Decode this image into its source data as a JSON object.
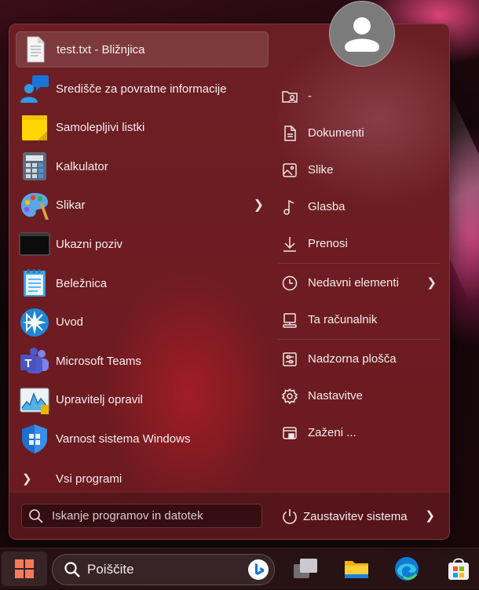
{
  "start_menu": {
    "apps": [
      {
        "label": "test.txt - Bližnjica",
        "icon": "text-file-icon"
      },
      {
        "label": "Središče za povratne informacije",
        "icon": "feedback-hub-icon"
      },
      {
        "label": "Samolepljivi listki",
        "icon": "sticky-notes-icon"
      },
      {
        "label": "Kalkulator",
        "icon": "calculator-icon"
      },
      {
        "label": "Slikar",
        "icon": "paint-icon"
      },
      {
        "label": "Ukazni poziv",
        "icon": "command-prompt-icon"
      },
      {
        "label": "Beležnica",
        "icon": "notepad-icon"
      },
      {
        "label": "Uvod",
        "icon": "get-started-icon"
      },
      {
        "label": "Microsoft Teams",
        "icon": "teams-icon"
      },
      {
        "label": "Upravitelj opravil",
        "icon": "task-manager-icon"
      },
      {
        "label": "Varnost sistema Windows",
        "icon": "windows-security-icon"
      }
    ],
    "all_programs_label": "Vsi programi",
    "search_placeholder": "Iskanje programov in datotek",
    "right_items": [
      {
        "label": "-",
        "icon": "user-folder-icon"
      },
      {
        "label": "Dokumenti",
        "icon": "document-icon"
      },
      {
        "label": "Slike",
        "icon": "pictures-icon"
      },
      {
        "label": "Glasba",
        "icon": "music-icon"
      },
      {
        "label": "Prenosi",
        "icon": "download-icon"
      },
      {
        "label": "Nedavni elementi",
        "icon": "clock-icon"
      },
      {
        "label": "Ta računalnik",
        "icon": "computer-icon"
      },
      {
        "label": "Nadzorna plošča",
        "icon": "control-panel-icon"
      },
      {
        "label": "Nastavitve",
        "icon": "gear-icon"
      },
      {
        "label": "Zaženi ...",
        "icon": "run-icon"
      }
    ],
    "power_label": "Zaustavitev sistema",
    "accent_color": "#6b1f24"
  },
  "taskbar": {
    "search_label": "Poiščite",
    "pinned": [
      "task-view-icon",
      "file-explorer-icon",
      "edge-icon",
      "microsoft-store-icon"
    ]
  }
}
